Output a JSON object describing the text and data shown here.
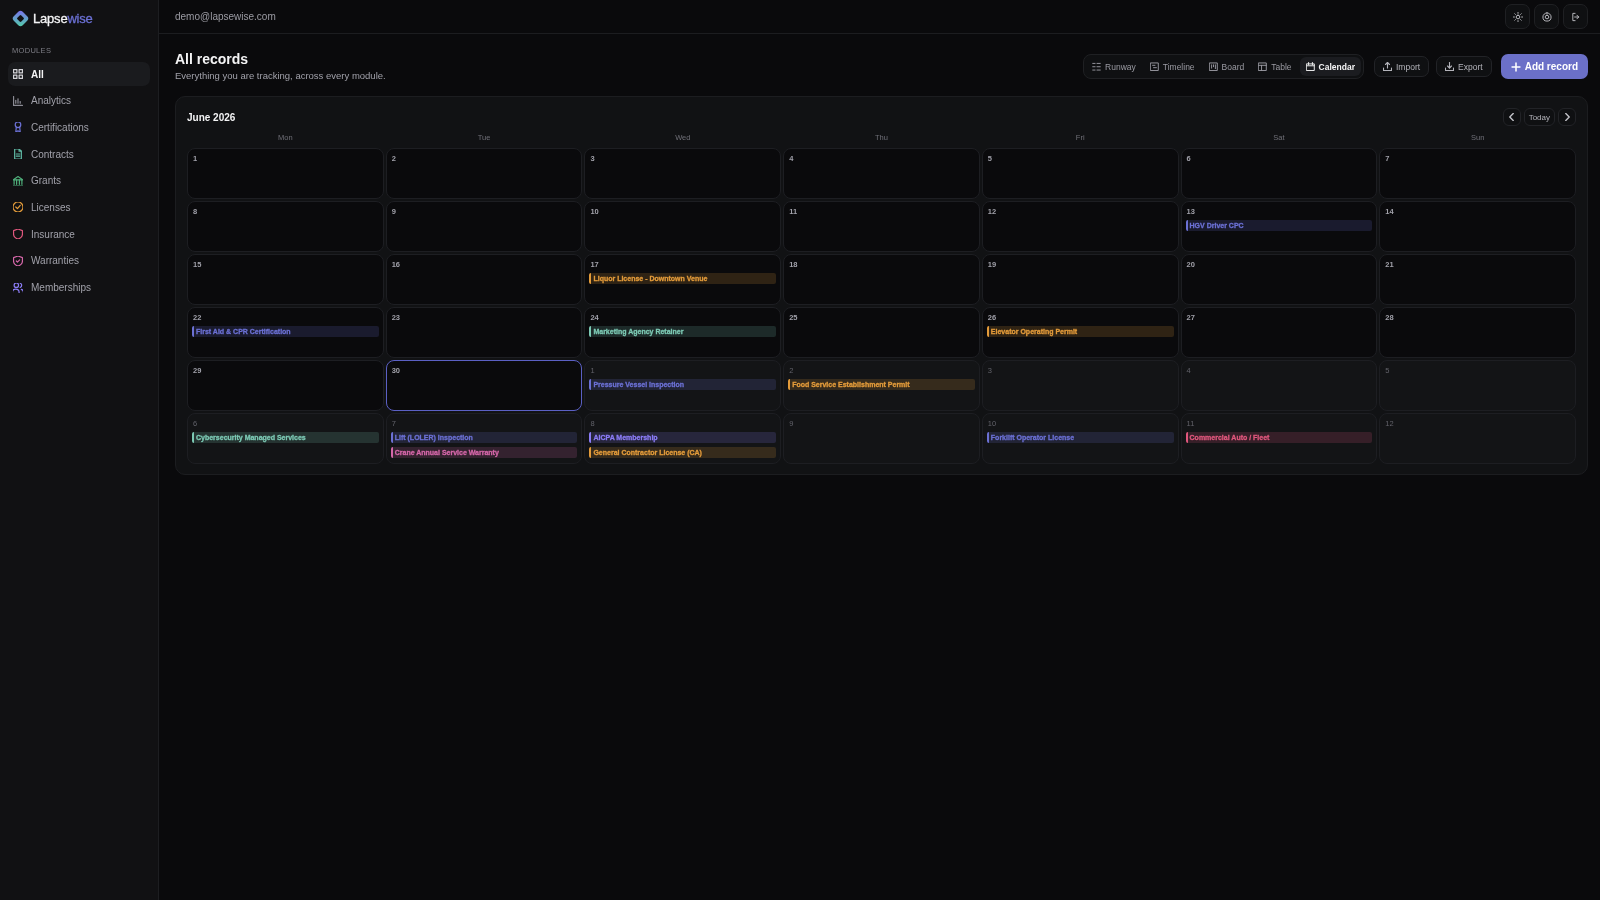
{
  "brand": {
    "name": "Lapse",
    "accent": "wise"
  },
  "sidebar": {
    "section": "MODULES",
    "items": [
      {
        "label": "All",
        "selected": true,
        "color": "#d4d4d8"
      },
      {
        "label": "Analytics",
        "selected": false,
        "color": "#8b8b94"
      },
      {
        "label": "Certifications",
        "selected": false,
        "color": "#6b70d4"
      },
      {
        "label": "Contracts",
        "selected": false,
        "color": "#5fb8a3"
      },
      {
        "label": "Grants",
        "selected": false,
        "color": "#4fae7a"
      },
      {
        "label": "Licenses",
        "selected": false,
        "color": "#e39b3a"
      },
      {
        "label": "Insurance",
        "selected": false,
        "color": "#e0577d"
      },
      {
        "label": "Warranties",
        "selected": false,
        "color": "#d567a9"
      },
      {
        "label": "Memberships",
        "selected": false,
        "color": "#8b7cf6"
      }
    ]
  },
  "header": {
    "email": "demo@lapsewise.com"
  },
  "page": {
    "title": "All records",
    "subtitle": "Everything you are tracking, across every module."
  },
  "views": [
    {
      "label": "Runway",
      "selected": false
    },
    {
      "label": "Timeline",
      "selected": false
    },
    {
      "label": "Board",
      "selected": false
    },
    {
      "label": "Table",
      "selected": false
    },
    {
      "label": "Calendar",
      "selected": true
    }
  ],
  "actions": [
    {
      "label": "Import",
      "kind": "secondary"
    },
    {
      "label": "Export",
      "kind": "secondary"
    },
    {
      "label": "Add record",
      "kind": "primary"
    }
  ],
  "calendar": {
    "title": "June 2026",
    "today_button": "Today",
    "weekdays": [
      "Mon",
      "Tue",
      "Wed",
      "Thu",
      "Fri",
      "Sat",
      "Sun"
    ],
    "weeks": [
      {
        "days": [
          {
            "day": "1",
            "in_month": true,
            "today": false
          },
          {
            "day": "2",
            "in_month": true,
            "today": false
          },
          {
            "day": "3",
            "in_month": true,
            "today": false
          },
          {
            "day": "4",
            "in_month": true,
            "today": false
          },
          {
            "day": "5",
            "in_month": true,
            "today": false
          },
          {
            "day": "6",
            "in_month": true,
            "today": false
          },
          {
            "day": "7",
            "in_month": true,
            "today": false
          }
        ]
      },
      {
        "days": [
          {
            "day": "8",
            "in_month": true,
            "today": false
          },
          {
            "day": "9",
            "in_month": true,
            "today": false
          },
          {
            "day": "10",
            "in_month": true,
            "today": false
          },
          {
            "day": "11",
            "in_month": true,
            "today": false
          },
          {
            "day": "12",
            "in_month": true,
            "today": false
          },
          {
            "day": "13",
            "in_month": true,
            "today": false,
            "events": [
              {
                "label": "HGV Driver CPC",
                "color": "#6b70d4"
              }
            ]
          },
          {
            "day": "14",
            "in_month": true,
            "today": false
          }
        ]
      },
      {
        "days": [
          {
            "day": "15",
            "in_month": true,
            "today": false
          },
          {
            "day": "16",
            "in_month": true,
            "today": false
          },
          {
            "day": "17",
            "in_month": true,
            "today": false,
            "events": [
              {
                "label": "Liquor License - Downtown Venue",
                "color": "#e39b3a"
              }
            ]
          },
          {
            "day": "18",
            "in_month": true,
            "today": false
          },
          {
            "day": "19",
            "in_month": true,
            "today": false
          },
          {
            "day": "20",
            "in_month": true,
            "today": false
          },
          {
            "day": "21",
            "in_month": true,
            "today": false
          }
        ]
      },
      {
        "days": [
          {
            "day": "22",
            "in_month": true,
            "today": false,
            "events": [
              {
                "label": "First Aid & CPR Certification",
                "color": "#6b70d4"
              }
            ]
          },
          {
            "day": "23",
            "in_month": true,
            "today": false
          },
          {
            "day": "24",
            "in_month": true,
            "today": false,
            "events": [
              {
                "label": "Marketing Agency Retainer",
                "color": "#7cc9b4"
              }
            ]
          },
          {
            "day": "25",
            "in_month": true,
            "today": false
          },
          {
            "day": "26",
            "in_month": true,
            "today": false,
            "events": [
              {
                "label": "Elevator Operating Permit",
                "color": "#e39b3a"
              }
            ]
          },
          {
            "day": "27",
            "in_month": true,
            "today": false
          },
          {
            "day": "28",
            "in_month": true,
            "today": false
          }
        ]
      },
      {
        "days": [
          {
            "day": "29",
            "in_month": true,
            "today": false
          },
          {
            "day": "30",
            "in_month": true,
            "today": true
          },
          {
            "day": "1",
            "in_month": false,
            "today": false,
            "events": [
              {
                "label": "Pressure Vessel Inspection",
                "color": "#6b70d4"
              }
            ]
          },
          {
            "day": "2",
            "in_month": false,
            "today": false,
            "events": [
              {
                "label": "Food Service Establishment Permit",
                "color": "#e39b3a"
              }
            ]
          },
          {
            "day": "3",
            "in_month": false,
            "today": false
          },
          {
            "day": "4",
            "in_month": false,
            "today": false
          },
          {
            "day": "5",
            "in_month": false,
            "today": false
          }
        ]
      },
      {
        "days": [
          {
            "day": "6",
            "in_month": false,
            "today": false,
            "events": [
              {
                "label": "Cybersecurity Managed Services",
                "color": "#7cc9b4"
              }
            ]
          },
          {
            "day": "7",
            "in_month": false,
            "today": false,
            "events": [
              {
                "label": "Lift (LOLER) Inspection",
                "color": "#6b70d4"
              },
              {
                "label": "Crane Annual Service Warranty",
                "color": "#d567a9"
              }
            ]
          },
          {
            "day": "8",
            "in_month": false,
            "today": false,
            "events": [
              {
                "label": "AICPA Membership",
                "color": "#8b7cf6"
              },
              {
                "label": "General Contractor License (CA)",
                "color": "#e39b3a"
              }
            ]
          },
          {
            "day": "9",
            "in_month": false,
            "today": false
          },
          {
            "day": "10",
            "in_month": false,
            "today": false,
            "events": [
              {
                "label": "Forklift Operator License",
                "color": "#6b70d4"
              }
            ]
          },
          {
            "day": "11",
            "in_month": false,
            "today": false,
            "events": [
              {
                "label": "Commercial Auto / Fleet",
                "color": "#e0577d"
              }
            ]
          },
          {
            "day": "12",
            "in_month": false,
            "today": false
          }
        ]
      }
    ]
  }
}
